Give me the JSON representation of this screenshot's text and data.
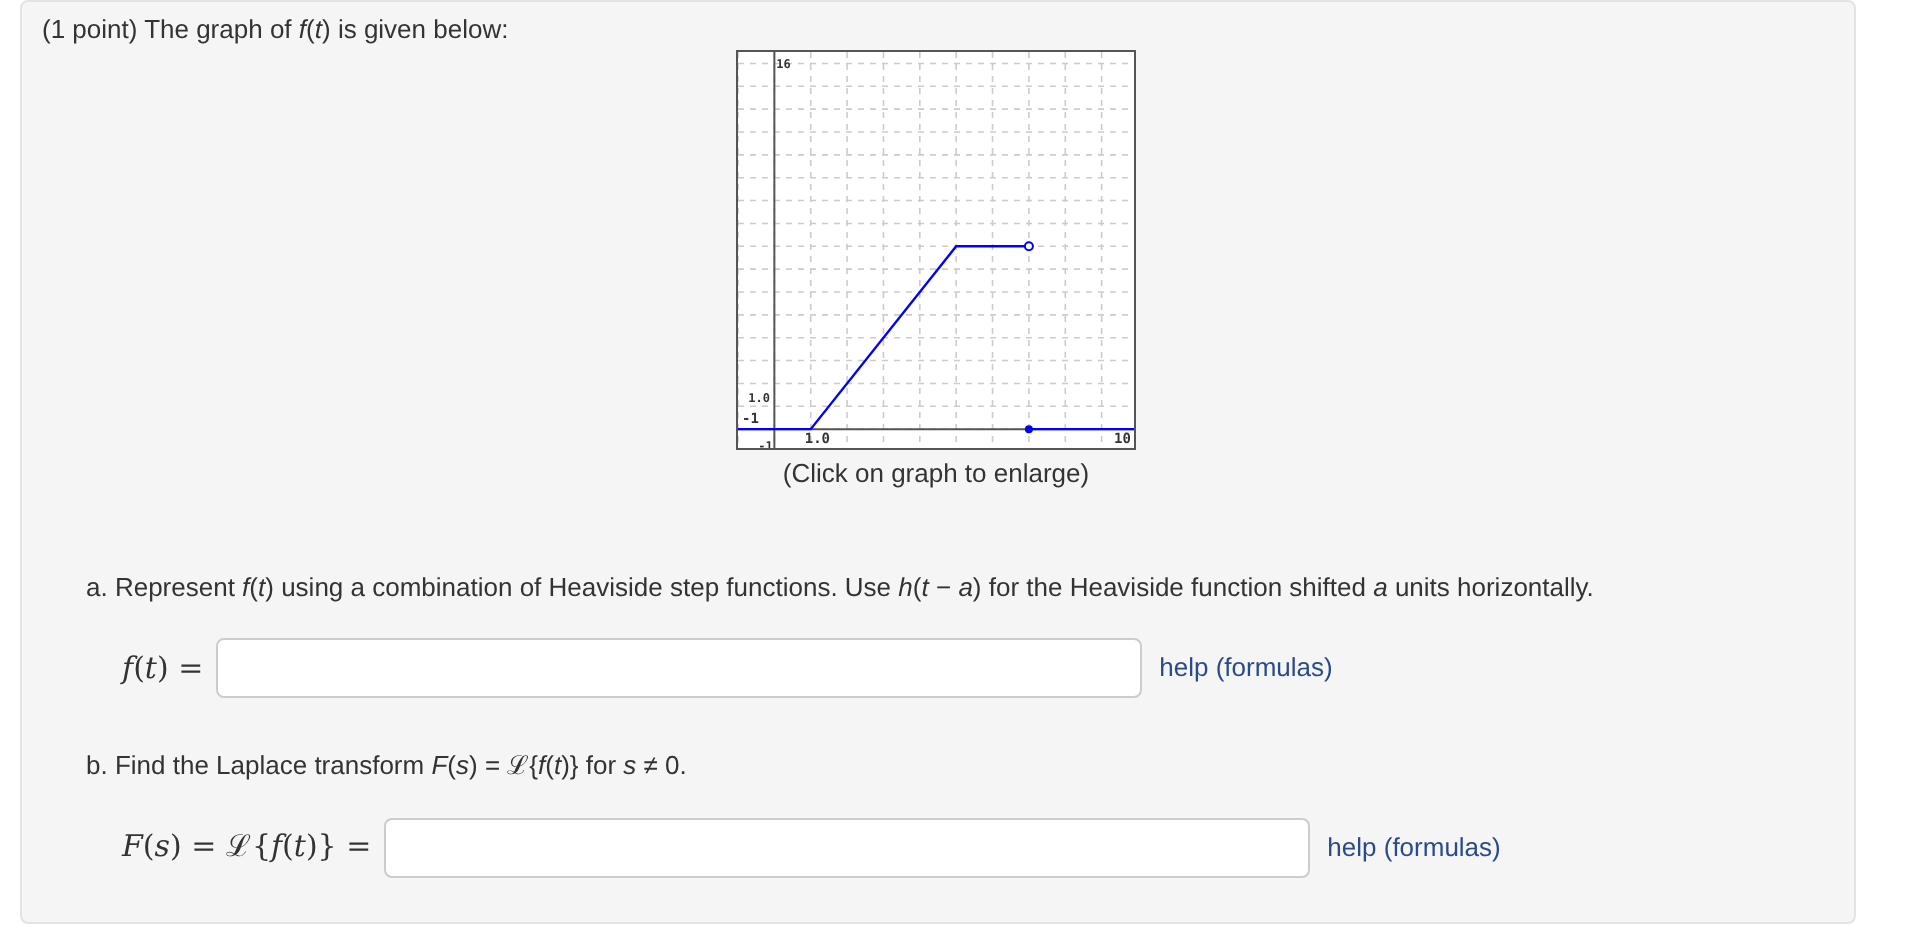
{
  "problem": {
    "intro": "(1 point) The graph of *f*(*t*) is given below:",
    "graph": {
      "caption": "(Click on graph to enlarge)",
      "x_tick_labels": [
        "-1",
        "1.0",
        "10"
      ],
      "y_tick_labels": [
        "-1",
        "1.0",
        "16"
      ]
    },
    "parts": [
      {
        "prompt": "a. Represent *f*(*t*) using a combination of Heaviside step functions. Use *h*(*t* − *a*) for the Heaviside function shifted *a* units horizontally.",
        "answer_label": "*f*(*t*) =",
        "help": "help (formulas)"
      },
      {
        "prompt": "b. Find the Laplace transform *F*(*s*) = ℒ{*f*(*t*)} for *s* ≠ 0.",
        "answer_label": "*F*(*s*) = ℒ{*f*(*t*)} =",
        "help": "help (formulas)"
      }
    ]
  }
}
